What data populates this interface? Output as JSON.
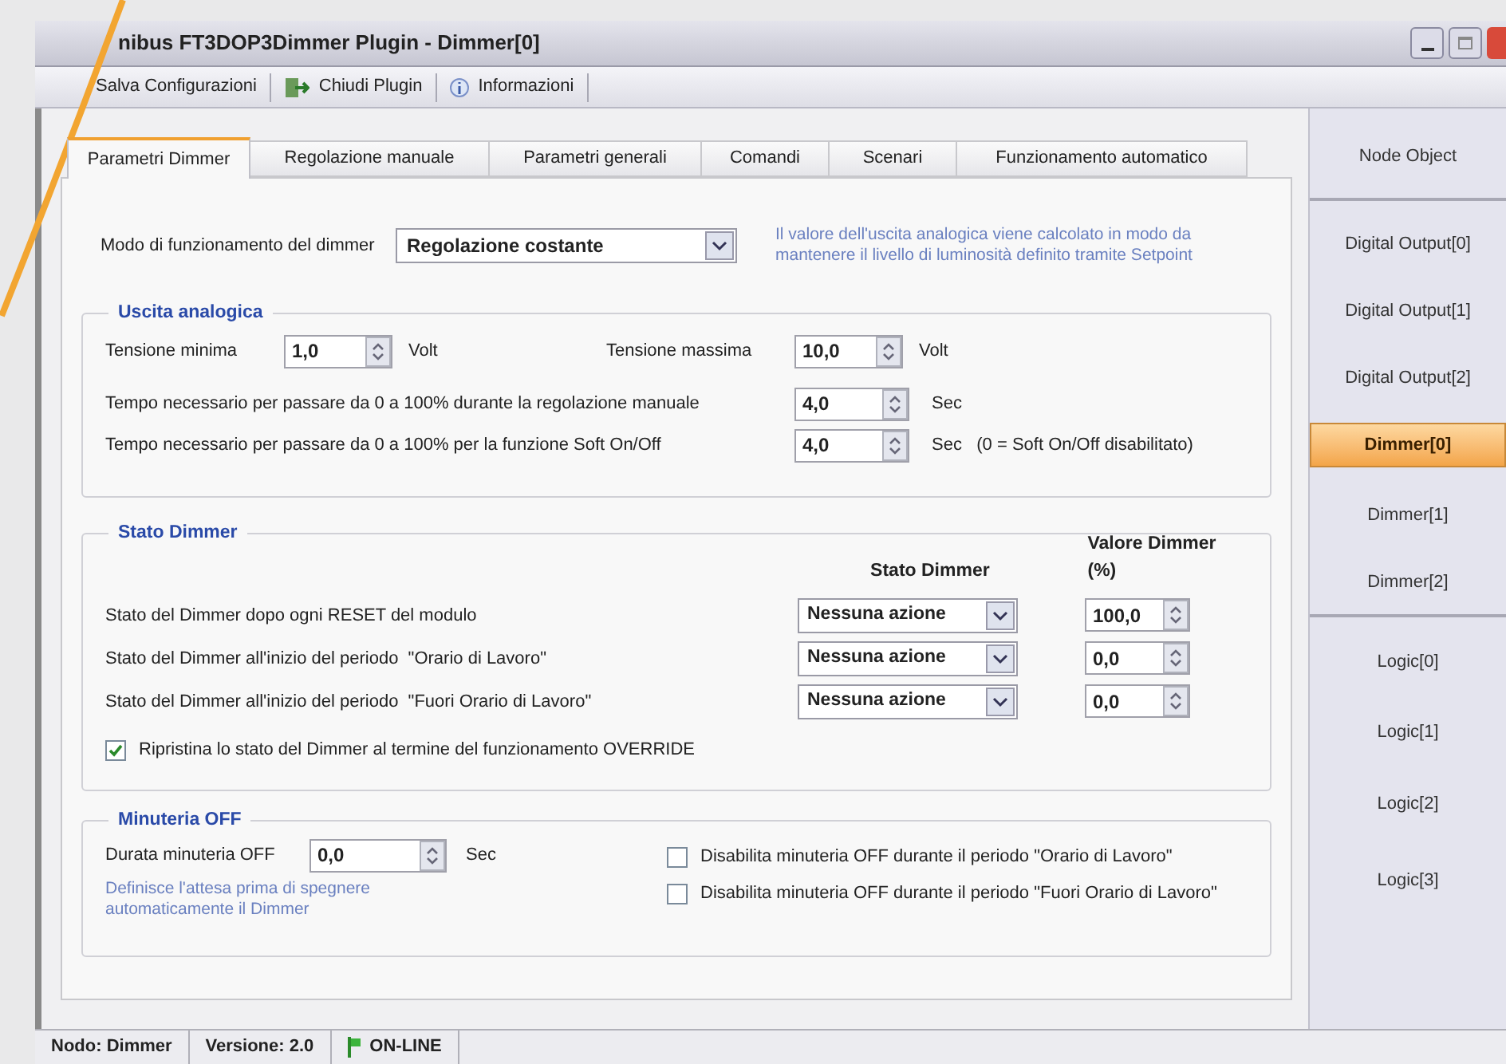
{
  "window": {
    "title": "nibus FT3DOP3Dimmer Plugin - Dimmer[0]"
  },
  "toolbar": [
    {
      "kind": "save",
      "label": "Salva Configurazioni"
    },
    {
      "kind": "close",
      "label": "Chiudi Plugin"
    },
    {
      "kind": "info",
      "label": "Informazioni"
    }
  ],
  "tabs": [
    {
      "label": "Parametri Dimmer",
      "selected": true
    },
    {
      "label": "Regolazione manuale",
      "selected": false
    },
    {
      "label": "Parametri generali",
      "selected": false
    },
    {
      "label": "Comandi",
      "selected": false
    },
    {
      "label": "Scenari",
      "selected": false
    },
    {
      "label": "Funzionamento automatico",
      "selected": false
    }
  ],
  "mode": {
    "label": "Modo di funzionamento del dimmer",
    "value": "Regolazione costante",
    "note": "Il valore dell'uscita analogica viene calcolato in modo da mantenere il livello di luminosità definito tramite Setpoint"
  },
  "analog": {
    "title": "Uscita analogica",
    "min": {
      "label": "Tensione minima",
      "value": "1,0",
      "unit": "Volt"
    },
    "max": {
      "label": "Tensione massima",
      "value": "10,0",
      "unit": "Volt"
    },
    "times": [
      {
        "label": "Tempo necessario per passare da 0 a 100% durante la regolazione manuale",
        "value": "4,0",
        "unit": "Sec"
      },
      {
        "label": "Tempo necessario per passare da 0 a 100% per la funzione Soft On/Off",
        "value": "4,0",
        "unit": "Sec   (0 = Soft On/Off disabilitato)"
      }
    ]
  },
  "state": {
    "title": "Stato Dimmer",
    "column_state": "Stato Dimmer",
    "column_value": "Valore Dimmer (%)",
    "rows": [
      {
        "label": "Stato del Dimmer dopo ogni RESET del modulo",
        "state": "Nessuna azione",
        "value": "100,0"
      },
      {
        "label": "Stato del Dimmer all'inizio del periodo  \"Orario di Lavoro\"",
        "state": "Nessuna azione",
        "value": "0,0"
      },
      {
        "label": "Stato del Dimmer all'inizio del periodo  \"Fuori Orario di Lavoro\"",
        "state": "Nessuna azione",
        "value": "0,0"
      }
    ],
    "restore": {
      "label": "Ripristina lo stato del Dimmer al termine del funzionamento OVERRIDE",
      "checked": true
    }
  },
  "timer": {
    "title": "Minuteria OFF",
    "label": "Durata minuteria OFF",
    "value": "0,0",
    "unit": "Sec",
    "hint": "Definisce l'attesa prima di spegnere automaticamente il Dimmer",
    "options": [
      {
        "label": "Disabilita minuteria OFF durante il periodo \"Orario di Lavoro\"",
        "checked": false
      },
      {
        "label": "Disabilita minuteria OFF durante il periodo \"Fuori Orario di Lavoro\"",
        "checked": false
      }
    ]
  },
  "sidebar": [
    {
      "label": "Node Object",
      "selected": false,
      "divider": true
    },
    {
      "label": "Digital Output[0]",
      "selected": false,
      "divider": false
    },
    {
      "label": "Digital Output[1]",
      "selected": false,
      "divider": false
    },
    {
      "label": "Digital Output[2]",
      "selected": false,
      "divider": false
    },
    {
      "label": "Dimmer[0]",
      "selected": true,
      "divider": false
    },
    {
      "label": "Dimmer[1]",
      "selected": false,
      "divider": false
    },
    {
      "label": "Dimmer[2]",
      "selected": false,
      "divider": true
    },
    {
      "label": "Logic[0]",
      "selected": false,
      "divider": false
    },
    {
      "label": "Logic[1]",
      "selected": false,
      "divider": false
    },
    {
      "label": "Logic[2]",
      "selected": false,
      "divider": false
    },
    {
      "label": "Logic[3]",
      "selected": false,
      "divider": false
    }
  ],
  "status_bar": [
    {
      "kind": "text",
      "label": "Nodo: Dimmer"
    },
    {
      "kind": "text",
      "label": "Versione: 2.0"
    },
    {
      "kind": "online",
      "label": "ON-LINE"
    }
  ]
}
